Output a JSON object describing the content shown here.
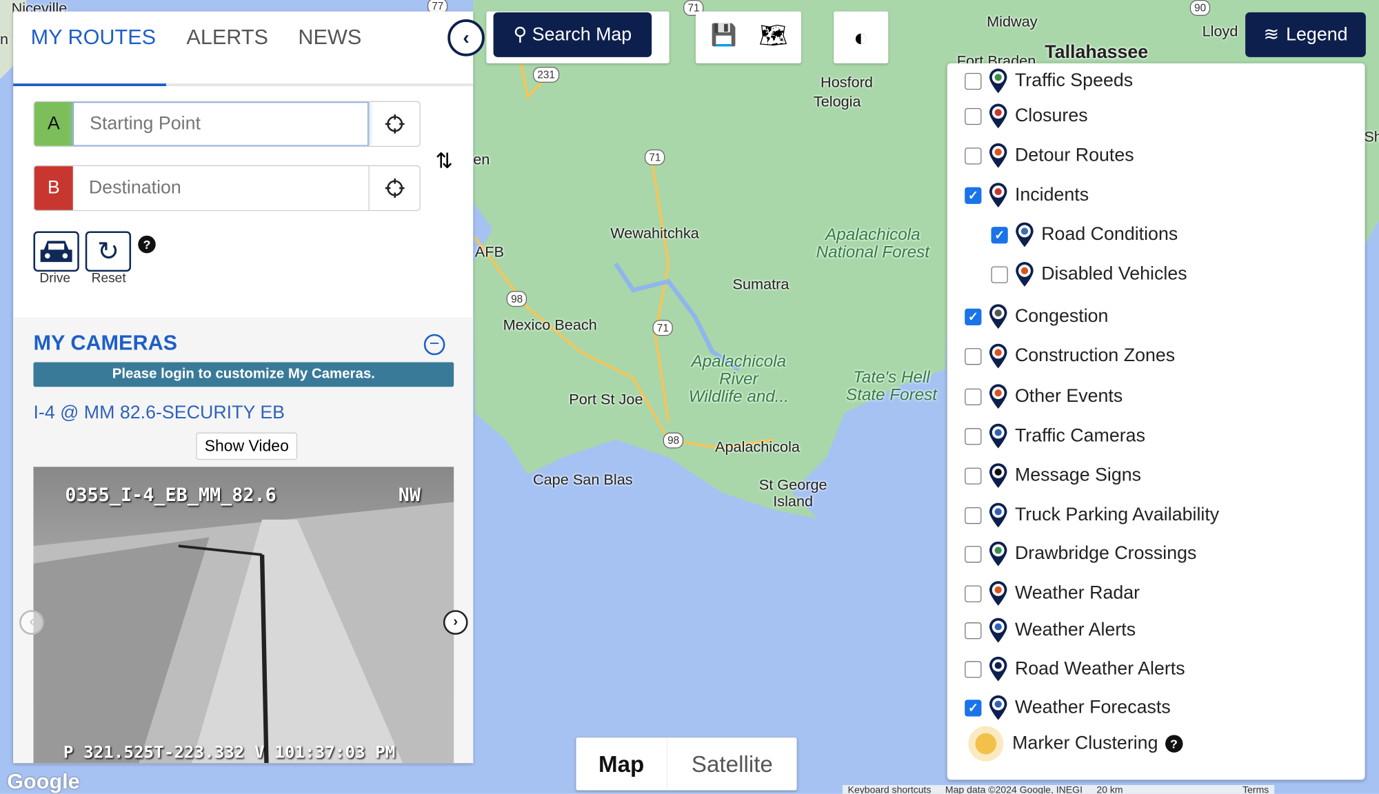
{
  "tabs": [
    {
      "label": "MY ROUTES",
      "active": true
    },
    {
      "label": "ALERTS"
    },
    {
      "label": "NEWS"
    }
  ],
  "route": {
    "a_label": "A",
    "b_label": "B",
    "start_placeholder": "Starting Point",
    "dest_placeholder": "Destination",
    "drive_label": "Drive",
    "reset_label": "Reset",
    "colors": {
      "a": "#7cbf5a",
      "b": "#c8372f"
    }
  },
  "cameras": {
    "title": "MY CAMERAS",
    "login_msg": "Please login to customize My Cameras.",
    "camera_name": "I-4 @ MM 82.6-SECURITY EB",
    "show_video": "Show Video",
    "overlay_top": "0355_I-4_EB_MM_82.6",
    "overlay_dir": "NW",
    "overlay_bottom": "P 321.525T-223.332 V 101:37:03 PM"
  },
  "toolbar": {
    "search": "Search Map",
    "legend": "Legend"
  },
  "legend": {
    "items": [
      {
        "label": "Traffic Speeds",
        "checked": false,
        "icon": "traffic-speeds-icon"
      },
      {
        "label": "Closures",
        "checked": false,
        "icon": "closures-icon"
      },
      {
        "label": "Detour Routes",
        "checked": false,
        "icon": "detour-icon"
      },
      {
        "label": "Incidents",
        "checked": true,
        "icon": "incidents-icon"
      },
      {
        "label": "Road Conditions",
        "checked": true,
        "icon": "road-conditions-icon",
        "sub": true
      },
      {
        "label": "Disabled Vehicles",
        "checked": false,
        "icon": "disabled-vehicles-icon",
        "sub": true
      },
      {
        "label": "Congestion",
        "checked": true,
        "icon": "congestion-icon"
      },
      {
        "label": "Construction Zones",
        "checked": false,
        "icon": "construction-icon"
      },
      {
        "label": "Other Events",
        "checked": false,
        "icon": "other-events-icon"
      },
      {
        "label": "Traffic Cameras",
        "checked": false,
        "icon": "camera-icon"
      },
      {
        "label": "Message Signs",
        "checked": false,
        "icon": "message-sign-icon"
      },
      {
        "label": "Truck Parking Availability",
        "checked": false,
        "icon": "truck-parking-icon"
      },
      {
        "label": "Drawbridge Crossings",
        "checked": false,
        "icon": "drawbridge-icon"
      },
      {
        "label": "Weather Radar",
        "checked": false,
        "icon": "weather-radar-icon"
      },
      {
        "label": "Weather Alerts",
        "checked": false,
        "icon": "weather-alerts-icon"
      },
      {
        "label": "Road Weather Alerts",
        "checked": false,
        "icon": "road-weather-icon"
      },
      {
        "label": "Weather Forecasts",
        "checked": true,
        "icon": "weather-forecast-icon"
      }
    ],
    "clustering": "Marker Clustering"
  },
  "maptype": {
    "map": "Map",
    "satellite": "Satellite",
    "selected": "Map"
  },
  "map_labels": {
    "niceville": "Niceville",
    "midway": "Midway",
    "tallahassee": "Tallahassee",
    "lloyd": "Lloyd",
    "hosford": "Hosford",
    "telogia": "Telogia",
    "fort": "Fort Braden",
    "wewahitchka": "Wewahitchka",
    "afb": "AFB",
    "apalach_forest": "Apalachicola\nNational Forest",
    "sumatra": "Sumatra",
    "mexico_beach": "Mexico Beach",
    "river": "Apalachicola\nRiver\nWildlife and...",
    "tates": "Tate's Hell\nState Forest",
    "port_st_joe": "Port St Joe",
    "apalachicola": "Apalachicola",
    "cape": "Cape San Blas",
    "st_george": "St George\nIsland",
    "sh": "Sh",
    "en": "en",
    "n": "n"
  },
  "shields": [
    "77",
    "231",
    "71",
    "98",
    "71",
    "98",
    "71",
    "90"
  ],
  "attribution": {
    "shortcuts": "Keyboard shortcuts",
    "mapdata": "Map data ©2024 Google, INEGI",
    "scale": "20 km",
    "terms": "Terms"
  },
  "google": "Google"
}
